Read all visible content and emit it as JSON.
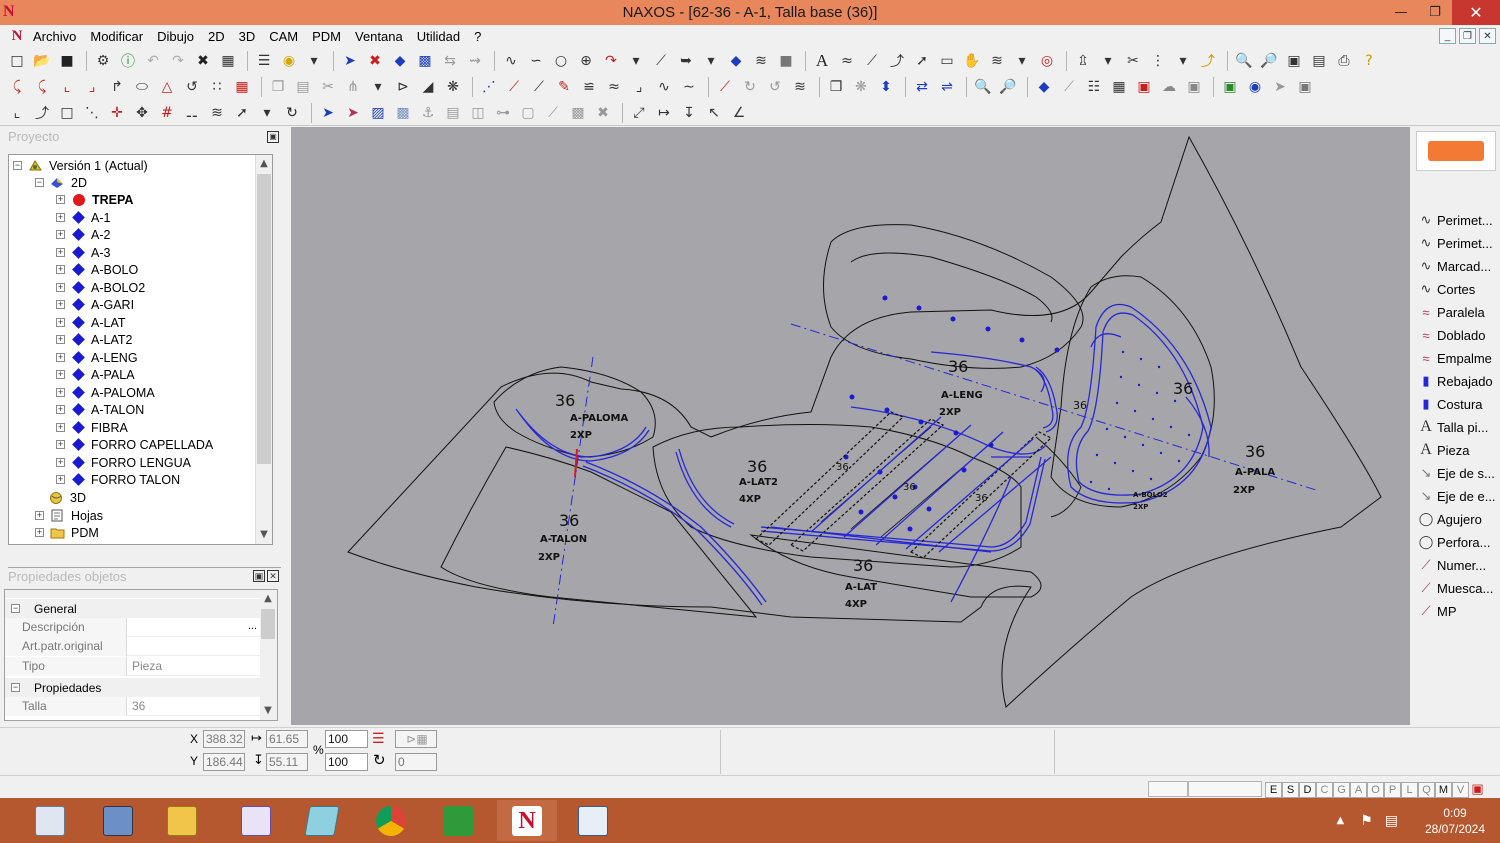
{
  "window": {
    "title": "NAXOS - [62-36 - A-1, Talla base (36)]"
  },
  "menu": [
    "Archivo",
    "Modificar",
    "Dibujo",
    "2D",
    "3D",
    "CAM",
    "PDM",
    "Ventana",
    "Utilidad",
    "?"
  ],
  "project_panel": {
    "header": "Proyecto",
    "tree": {
      "root": "Versión 1 (Actual)",
      "folder_2d": "2D",
      "pieces": [
        "TREPA",
        "A-1",
        "A-2",
        "A-3",
        "A-BOLO",
        "A-BOLO2",
        "A-GARI",
        "A-LAT",
        "A-LAT2",
        "A-LENG",
        "A-PALA",
        "A-PALOMA",
        "A-TALON",
        "FIBRA",
        "FORRO CAPELLADA",
        "FORRO LENGUA",
        "FORRO TALON"
      ],
      "folder_3d": "3D",
      "hojas": "Hojas",
      "pdm": "PDM"
    }
  },
  "properties_panel": {
    "header": "Propiedades objetos",
    "section_general": "General",
    "descripcion_label": "Descripción",
    "descripcion_btn": "...",
    "art_label": "Art.patr.original",
    "tipo_label": "Tipo",
    "tipo_value": "Pieza",
    "section_props": "Propiedades",
    "talla_label": "Talla",
    "talla_value": "36"
  },
  "canvas_labels": {
    "paloma": {
      "size": "36",
      "name": "A-PALOMA",
      "qty": "2XP"
    },
    "talon": {
      "size": "36",
      "name": "A-TALON",
      "qty": "2XP"
    },
    "lat2": {
      "size": "36",
      "name": "A-LAT2",
      "qty": "4XP"
    },
    "lat": {
      "size": "36",
      "name": "A-LAT",
      "qty": "4XP"
    },
    "leng": {
      "size": "36",
      "name": "A-LENG",
      "qty": "2XP"
    },
    "pala": {
      "size": "36",
      "name": "A-PALA",
      "qty": "2XP"
    },
    "bolo2": {
      "size": "36",
      "name": "A-BOLO2",
      "qty": "2XP"
    },
    "small_36": "36"
  },
  "right_panel": {
    "items": [
      "Perimet...",
      "Perimet...",
      "Marcad...",
      "Cortes",
      "Paralela",
      "Doblado",
      "Empalme",
      "Rebajado",
      "Costura",
      "Talla pi...",
      "Pieza",
      "Eje de s...",
      "Eje de e...",
      "Agujero",
      "Perfora...",
      "Numer...",
      "Muesca...",
      "MP"
    ]
  },
  "coords": {
    "x_label": "X",
    "y_label": "Y",
    "x": "388.32",
    "y": "186.44",
    "w": "61.65",
    "h": "55.11",
    "pct_label": "%",
    "scale_x": "100",
    "scale_y": "100",
    "angle": "0"
  },
  "status_modes": [
    "E",
    "S",
    "D",
    "C",
    "G",
    "A",
    "O",
    "P",
    "L",
    "Q",
    "M",
    "V"
  ],
  "taskbar": {
    "time": "0:09",
    "date": "28/07/2024"
  },
  "colors": {
    "titlebar": "#e8875b",
    "canvas": "#a6a6aa",
    "taskbar": "#b5582f",
    "tree_diamond": "#1a1ad2",
    "trepa_dot": "#e21717"
  }
}
